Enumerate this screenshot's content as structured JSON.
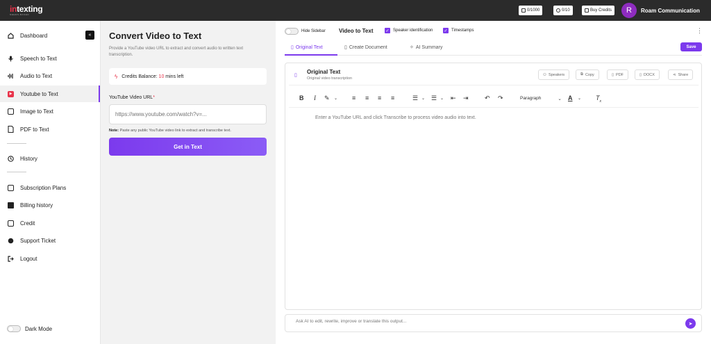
{
  "brand": {
    "name_prefix": "in",
    "name_suffix": "texting",
    "tagline": "NEEDS-BASED"
  },
  "topbar": {
    "credits_count": "0/1000",
    "timer_count": "0/10",
    "buy_credits": "Buy Credits",
    "avatar_letter": "R",
    "username": "Roam Communication"
  },
  "sidebar": {
    "items": [
      {
        "label": "Dashboard",
        "icon": "dashboard-icon"
      },
      {
        "label": "Speech to Text",
        "icon": "microphone-icon"
      },
      {
        "label": "Audio to Text",
        "icon": "audio-wave-icon"
      },
      {
        "label": "Youtube to Text",
        "icon": "youtube-icon"
      },
      {
        "label": "Image to Text",
        "icon": "image-icon"
      },
      {
        "label": "PDF to Text",
        "icon": "document-icon"
      },
      {
        "label": "History",
        "icon": "history-icon"
      },
      {
        "label": "Subscription Plans",
        "icon": "plans-icon"
      },
      {
        "label": "Billing history",
        "icon": "billing-icon"
      },
      {
        "label": "Credit",
        "icon": "credit-icon"
      },
      {
        "label": "Support Ticket",
        "icon": "support-icon"
      },
      {
        "label": "Logout",
        "icon": "logout-icon"
      }
    ],
    "active_index": 3,
    "dark_mode_label": "Dark Mode"
  },
  "converter": {
    "title": "Convert Video to Text",
    "description": "Provide a YouTube video URL to extract and convert audio to written text transcription.",
    "credits_label": "Credits Balance:",
    "credits_value": "10",
    "credits_unit": "mins left",
    "url_label": "YouTube Video URL",
    "url_required_mark": "*",
    "url_placeholder": "https://www.youtube.com/watch?v=...",
    "note_label": "Note:",
    "note_text": "Paste any public YouTube video link to extract and transcribe text.",
    "submit_label": "Get in Text"
  },
  "workspace": {
    "hide_sidebar_label": "Hide Sidebar",
    "title": "Video to Text",
    "speaker_identification_label": "Speaker identification",
    "timestamps_label": "Timestamps",
    "tabs": [
      {
        "label": "Original Text"
      },
      {
        "label": "Create Document"
      },
      {
        "label": "AI Summary"
      }
    ],
    "active_tab": 0,
    "save_label": "Save",
    "editor": {
      "title": "Original Text",
      "subtitle": "Original video transcription",
      "actions": [
        "Speakers",
        "Copy",
        "PDF",
        "DOCX",
        "Share"
      ],
      "paragraph_style": "Paragraph",
      "placeholder": "Enter a YouTube URL and click Transcribe to process video audio into text."
    },
    "ask_placeholder": "Ask AI to edit, rewrite, improve or translate this output..."
  },
  "colors": {
    "accent": "#7c3aed",
    "brand_red": "#e8334a",
    "topbar": "#2b2b2b",
    "avatar": "#8e2cbf"
  }
}
